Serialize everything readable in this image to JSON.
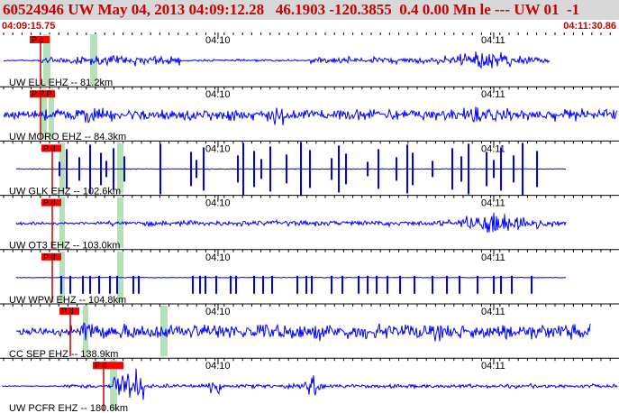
{
  "header": {
    "title": "60524946 UW May 04, 2013 04:09:12.28   46.1903 -120.3855  0.4 0.00 Mn le --- UW 01  -1",
    "time_start": "04:09:15.75",
    "time_end": "04:11:30.86"
  },
  "colors": {
    "header_bg": "#d8d8d8",
    "header_text": "#cc0000",
    "trace": "#0000ff",
    "pick_box": "#ff0000",
    "pick_line": "#cc0000",
    "window_band": "#b8e0b8"
  },
  "tick_labels": [
    "04:10",
    "04:11"
  ],
  "traces": [
    {
      "label": "UW ELL EHZ -- 81.2km",
      "pick": "P c",
      "style": "burst"
    },
    {
      "label": "UW MORO EHZ -- 84.3km",
      "pick": "P P P",
      "style": "noisy"
    },
    {
      "label": "UW GLK EHZ -- 102.6km",
      "pick": "P d",
      "style": "spikes"
    },
    {
      "label": "UW OT3 EHZ -- 103.0km",
      "pick": "P d",
      "style": "burst2"
    },
    {
      "label": "UW WPW EHZ -- 104.8km",
      "pick": "P d",
      "style": "clip"
    },
    {
      "label": "CC SEP EHZ -- 138.9km",
      "pick": "P d",
      "style": "noisy2"
    },
    {
      "label": "UW PCFR EHZ -- 180.6km",
      "pick": "P d",
      "style": "events"
    }
  ]
}
